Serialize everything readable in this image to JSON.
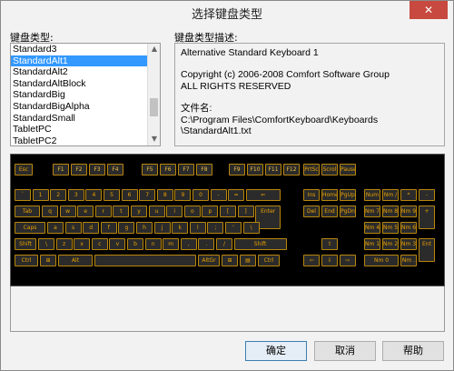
{
  "window": {
    "title": "选择键盘类型",
    "close_label": "✕"
  },
  "types_label": "键盘类型:",
  "desc_label": "键盘类型描述:",
  "list": {
    "items": [
      "Standard3",
      "StandardAlt1",
      "StandardAlt2",
      "StandardAltBlock",
      "StandardBig",
      "StandardBigAlpha",
      "StandardSmall",
      "TabletPC",
      "TabletPC2"
    ],
    "selected": "StandardAlt1"
  },
  "description": {
    "line1": "Alternative Standard Keyboard 1",
    "line2": "Copyright (c) 2006-2008  Comfort Software Group",
    "line3": "ALL RIGHTS RESERVED",
    "line4": "文件名:",
    "line5": "C:\\Program Files\\ComfortKeyboard\\Keyboards",
    "line6": "\\StandardAlt1.txt"
  },
  "keyboard": {
    "row0": [
      "Esc",
      "F1",
      "F2",
      "F3",
      "F4",
      "F5",
      "F6",
      "F7",
      "F8",
      "F9",
      "F10",
      "F11",
      "F12",
      "PrtSc",
      "Scrol",
      "Pause"
    ],
    "row1": [
      "`",
      "1",
      "2",
      "3",
      "4",
      "5",
      "6",
      "7",
      "8",
      "9",
      "0",
      "-",
      "=",
      "⇐",
      "Ins",
      "Home",
      "PgUp",
      "Num",
      "Nm /",
      "*",
      "-"
    ],
    "row2": [
      "Tab",
      "q",
      "w",
      "e",
      "r",
      "t",
      "y",
      "u",
      "i",
      "o",
      "p",
      "[",
      "]",
      "Enter",
      "Del",
      "End",
      "PgDn",
      "Nm 7",
      "Nm 8",
      "Nm 9",
      "+"
    ],
    "row3": [
      "Caps",
      "a",
      "s",
      "d",
      "f",
      "g",
      "h",
      "j",
      "k",
      "l",
      ";",
      "'",
      "\\",
      "Nm 4",
      "Nm 5",
      "Nm 6"
    ],
    "row4": [
      "Shift",
      "\\",
      "z",
      "x",
      "c",
      "v",
      "b",
      "n",
      "m",
      ",",
      ".",
      "/",
      "Shift",
      "⇧",
      "Nm 1",
      "Nm 2",
      "Nm 3",
      "Ent"
    ],
    "row5": [
      "Ctrl",
      "⊞",
      "Alt",
      "",
      "AltGr",
      "⊞",
      "▤",
      "Ctrl",
      "⇦",
      "⇩",
      "⇨",
      "Nm 0",
      "Nm ."
    ]
  },
  "buttons": {
    "ok": "确定",
    "cancel": "取消",
    "help": "帮助"
  }
}
